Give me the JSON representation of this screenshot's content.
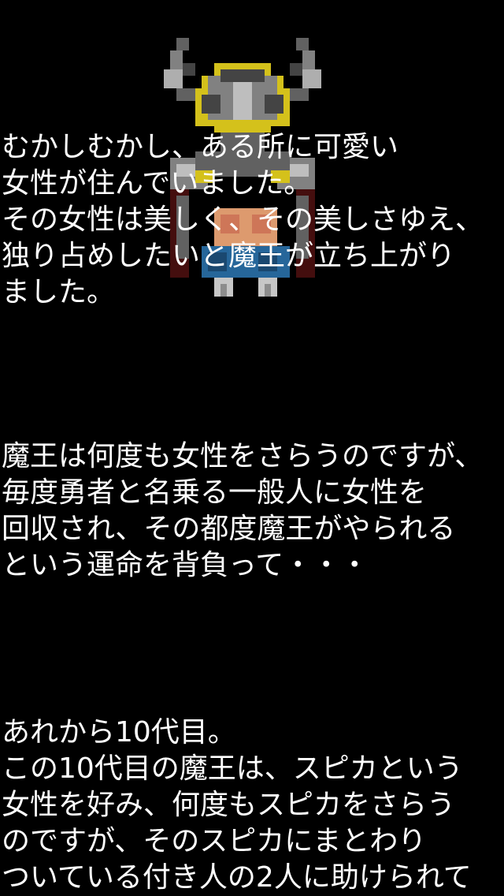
{
  "scene": {
    "background_color": "#000000",
    "sprite": {
      "name": "demon-king-sprite",
      "colors": {
        "armor": "#8c8c8c",
        "armor_dark": "#4a4a4a",
        "armor_light": "#cfcfcf",
        "trim": "#e6d21e",
        "skin": "#f0a878",
        "skirt": "#2a6fa8",
        "cape": "#5a1010",
        "boots": "#d8d8d8"
      }
    }
  },
  "story": {
    "blocks": [
      {
        "lines": [
          "むかしむかし、ある所に可愛い",
          "女性が住んでいました。",
          "その女性は美しく、その美しさゆえ、",
          "独り占めしたいと魔王が立ち上がり",
          "ました。"
        ]
      },
      {
        "lines": [
          "魔王は何度も女性をさらうのですが、",
          "毎度勇者と名乗る一般人に女性を",
          "回収され、その都度魔王がやられる",
          "という運命を背負って・・・"
        ]
      },
      {
        "lines": [
          "あれから10代目。",
          "この10代目の魔王は、スピカという",
          "女性を好み、何度もスピカをさらう",
          "のですが、そのスピカにまとわり",
          "ついている付き人の2人に助けられて"
        ]
      }
    ]
  }
}
